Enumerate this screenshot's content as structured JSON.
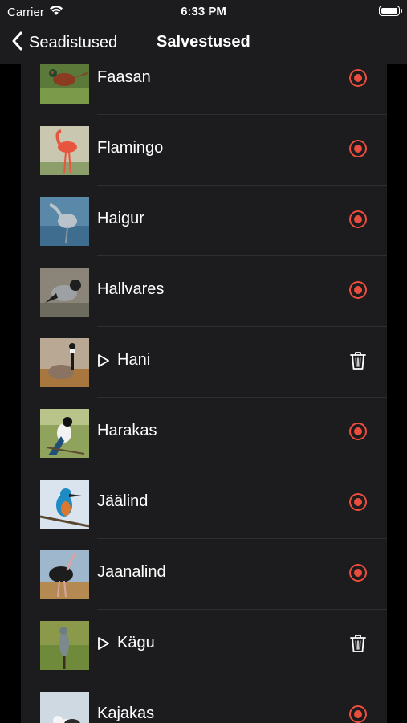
{
  "status_bar": {
    "carrier": "Carrier",
    "time": "6:33 PM",
    "wifi_icon": "wifi-icon",
    "battery_icon": "battery-icon"
  },
  "nav": {
    "back_label": "Seadistused",
    "title": "Salvestused",
    "back_icon": "chevron-left-icon"
  },
  "colors": {
    "accent_red": "#eb4d3d",
    "background": "#000000",
    "list_background": "#1c1c1e",
    "separator": "#2f2f33"
  },
  "birds": [
    {
      "name": "Faasan",
      "state": "record",
      "icon": "record-icon"
    },
    {
      "name": "Flamingo",
      "state": "record",
      "icon": "record-icon"
    },
    {
      "name": "Haigur",
      "state": "record",
      "icon": "record-icon"
    },
    {
      "name": "Hallvares",
      "state": "record",
      "icon": "record-icon"
    },
    {
      "name": "Hani",
      "state": "saved",
      "icon": "trash-icon",
      "play_icon": "play-icon"
    },
    {
      "name": "Harakas",
      "state": "record",
      "icon": "record-icon"
    },
    {
      "name": "Jäälind",
      "state": "record",
      "icon": "record-icon"
    },
    {
      "name": "Jaanalind",
      "state": "record",
      "icon": "record-icon"
    },
    {
      "name": "Kägu",
      "state": "saved",
      "icon": "trash-icon",
      "play_icon": "play-icon"
    },
    {
      "name": "Kajakas",
      "state": "record",
      "icon": "record-icon"
    }
  ]
}
